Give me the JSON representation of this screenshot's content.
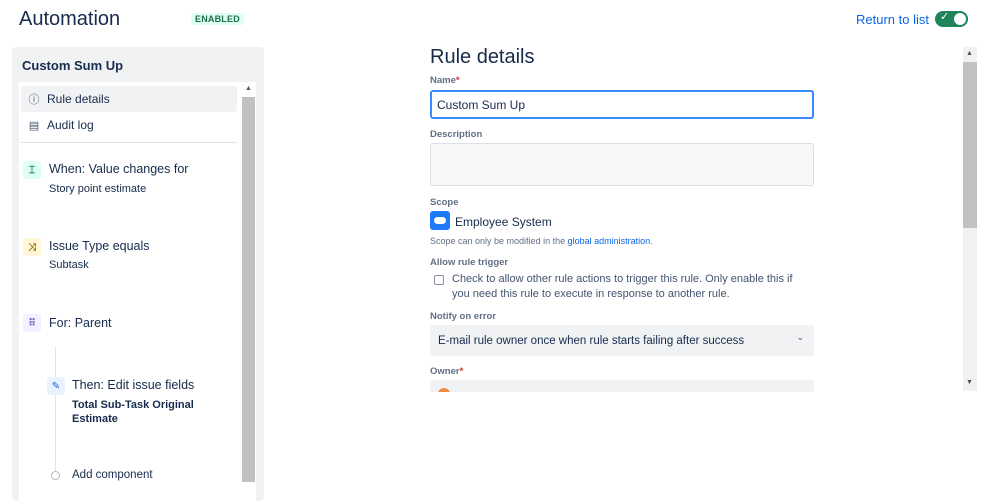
{
  "header": {
    "title": "Automation",
    "status_badge": "ENABLED",
    "return_link": "Return to list",
    "toggle_check": "✓"
  },
  "sidebar": {
    "rule_name": "Custom Sum Up",
    "nav": [
      {
        "icon": "info-icon",
        "glyph": "ⓘ",
        "label": "Rule details"
      },
      {
        "icon": "document-icon",
        "glyph": "▤",
        "label": "Audit log"
      }
    ],
    "components": [
      {
        "icon": "trigger-icon",
        "glyph": "⌶",
        "title": "When: Value changes for",
        "subtitle": "Story point estimate"
      },
      {
        "icon": "shuffle-icon",
        "glyph": "⤨",
        "title": "Issue Type equals",
        "subtitle": "Subtask"
      },
      {
        "icon": "hierarchy-icon",
        "glyph": "⠿",
        "title": "For: Parent"
      },
      {
        "icon": "pencil-icon",
        "glyph": "✎",
        "title": "Then: Edit issue fields",
        "subtitle": "Total Sub-Task Original Estimate"
      }
    ],
    "add_component": "Add component"
  },
  "details": {
    "title": "Rule details",
    "name_label": "Name",
    "required_mark": "*",
    "name_value": "Custom Sum Up",
    "description_label": "Description",
    "description_value": "",
    "scope_label": "Scope",
    "scope_name": "Employee System",
    "scope_note_prefix": "Scope can only be modified in the ",
    "scope_note_link": "global administration",
    "scope_note_suffix": ".",
    "allow_trigger_label": "Allow rule trigger",
    "allow_trigger_text": "Check to allow other rule actions to trigger this rule. Only enable this if you need this rule to execute in response to another rule.",
    "notify_label": "Notify on error",
    "notify_value": "E-mail rule owner once when rule starts failing after success",
    "owner_label": "Owner"
  },
  "colors": {
    "accent": "#0c66e4",
    "toggle_on": "#1f845a",
    "trigger": "#4bce97",
    "condition": "#f5cd47",
    "branch": "#9f8fef",
    "action": "#579dff"
  }
}
